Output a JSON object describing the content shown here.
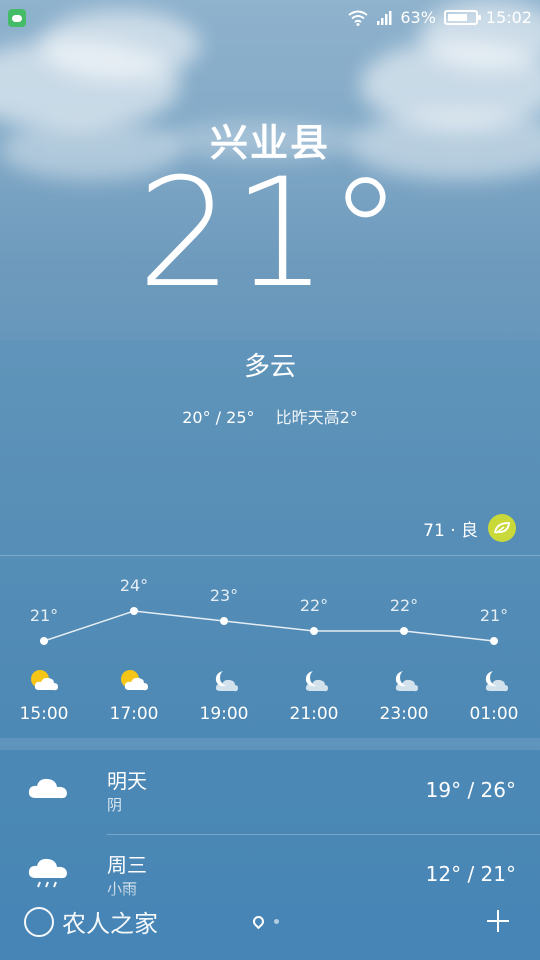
{
  "status_bar": {
    "battery": "63%",
    "time": "15:02",
    "battery_level": 0.63
  },
  "current": {
    "city": "兴业县",
    "temperature": "21°",
    "condition": "多云",
    "range": "20° / 25°",
    "comparison": "比昨天高2°"
  },
  "air_quality": {
    "text": "71 · 良",
    "color": "#c9d93a"
  },
  "hourly": [
    {
      "time": "15:00",
      "temp": "21°",
      "value": 21,
      "icon": "partly-sunny-icon"
    },
    {
      "time": "17:00",
      "temp": "24°",
      "value": 24,
      "icon": "partly-sunny-icon"
    },
    {
      "time": "19:00",
      "temp": "23°",
      "value": 23,
      "icon": "cloudy-night-icon"
    },
    {
      "time": "21:00",
      "temp": "22°",
      "value": 22,
      "icon": "cloudy-night-icon"
    },
    {
      "time": "23:00",
      "temp": "22°",
      "value": 22,
      "icon": "cloudy-night-icon"
    },
    {
      "time": "01:00",
      "temp": "21°",
      "value": 21,
      "icon": "cloudy-night-icon"
    }
  ],
  "forecast": [
    {
      "day": "明天",
      "condition": "阴",
      "temps": "19° / 26°",
      "icon": "cloud-icon"
    },
    {
      "day": "周三",
      "condition": "小雨",
      "temps": "12° / 21°",
      "icon": "rain-cloud-icon"
    }
  ],
  "bottom": {
    "brand": "农人之家",
    "add_icon": "plus-icon"
  }
}
